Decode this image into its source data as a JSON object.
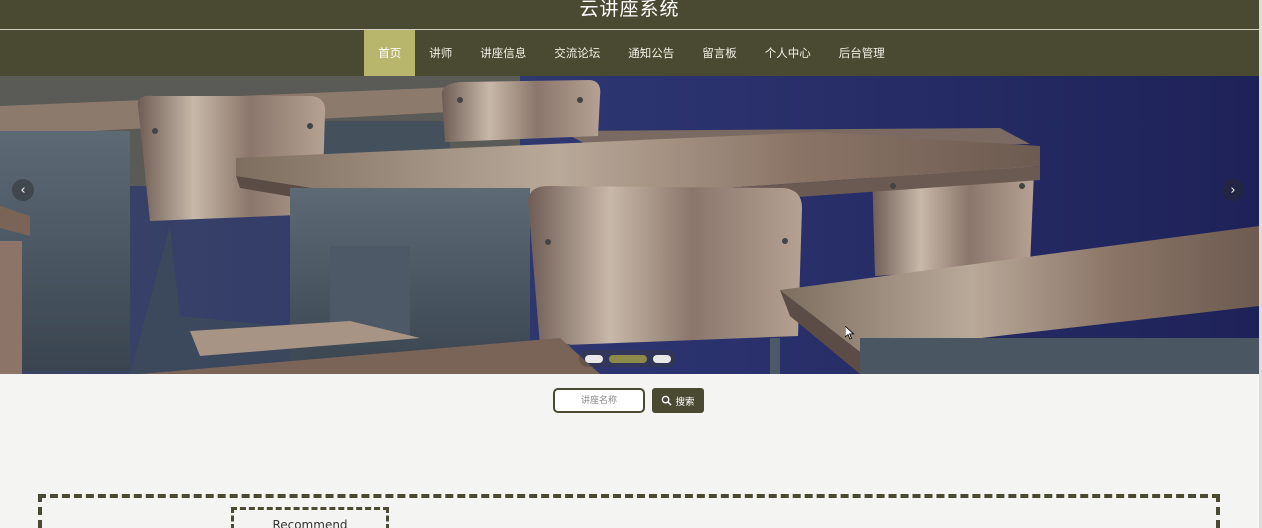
{
  "header": {
    "title": "云讲座系统"
  },
  "nav": {
    "items": [
      {
        "label": "首页",
        "active": true
      },
      {
        "label": "讲师",
        "active": false
      },
      {
        "label": "讲座信息",
        "active": false
      },
      {
        "label": "交流论坛",
        "active": false
      },
      {
        "label": "通知公告",
        "active": false
      },
      {
        "label": "留言板",
        "active": false
      },
      {
        "label": "个人中心",
        "active": false
      },
      {
        "label": "后台管理",
        "active": false
      }
    ]
  },
  "banner": {
    "prev_icon": "chevron-left-icon",
    "next_icon": "chevron-right-icon",
    "slide_count": 3,
    "active_slide": 2
  },
  "search": {
    "placeholder": "讲座名称",
    "button_label": "搜索",
    "button_icon": "search-icon"
  },
  "recommend": {
    "title": "Recommend"
  },
  "colors": {
    "primary": "#4a4a32",
    "accent": "#b8b66c",
    "background": "#f4f4f2"
  }
}
